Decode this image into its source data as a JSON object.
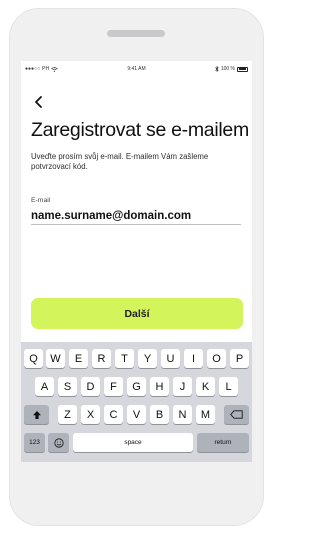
{
  "status_bar": {
    "carrier": "PH",
    "time": "9:41 AM",
    "battery": "100 %"
  },
  "header": {
    "back_icon": "chevron-left-icon"
  },
  "main": {
    "title": "Zaregistrovat se e-mailem",
    "subtitle": "Uveďte prosím svůj e-mail. E-mailem Vám zašleme potvrzovací kód.",
    "email_label": "E-mail",
    "email_value": "name.surname@domain.com",
    "next_label": "Další"
  },
  "keyboard": {
    "row1": [
      "Q",
      "W",
      "E",
      "R",
      "T",
      "Y",
      "U",
      "I",
      "O",
      "P"
    ],
    "row2": [
      "A",
      "S",
      "D",
      "F",
      "G",
      "H",
      "J",
      "K",
      "L"
    ],
    "row3": [
      "Z",
      "X",
      "C",
      "V",
      "B",
      "N",
      "M"
    ],
    "numbers_label": "123",
    "space_label": "space",
    "return_label": "return",
    "shift_icon": "shift-icon",
    "backspace_icon": "backspace-icon",
    "emoji_icon": "emoji-icon"
  },
  "colors": {
    "accent": "#d3f45b",
    "device": "#f0f0f1",
    "keyboard": "#d5d7dd"
  }
}
